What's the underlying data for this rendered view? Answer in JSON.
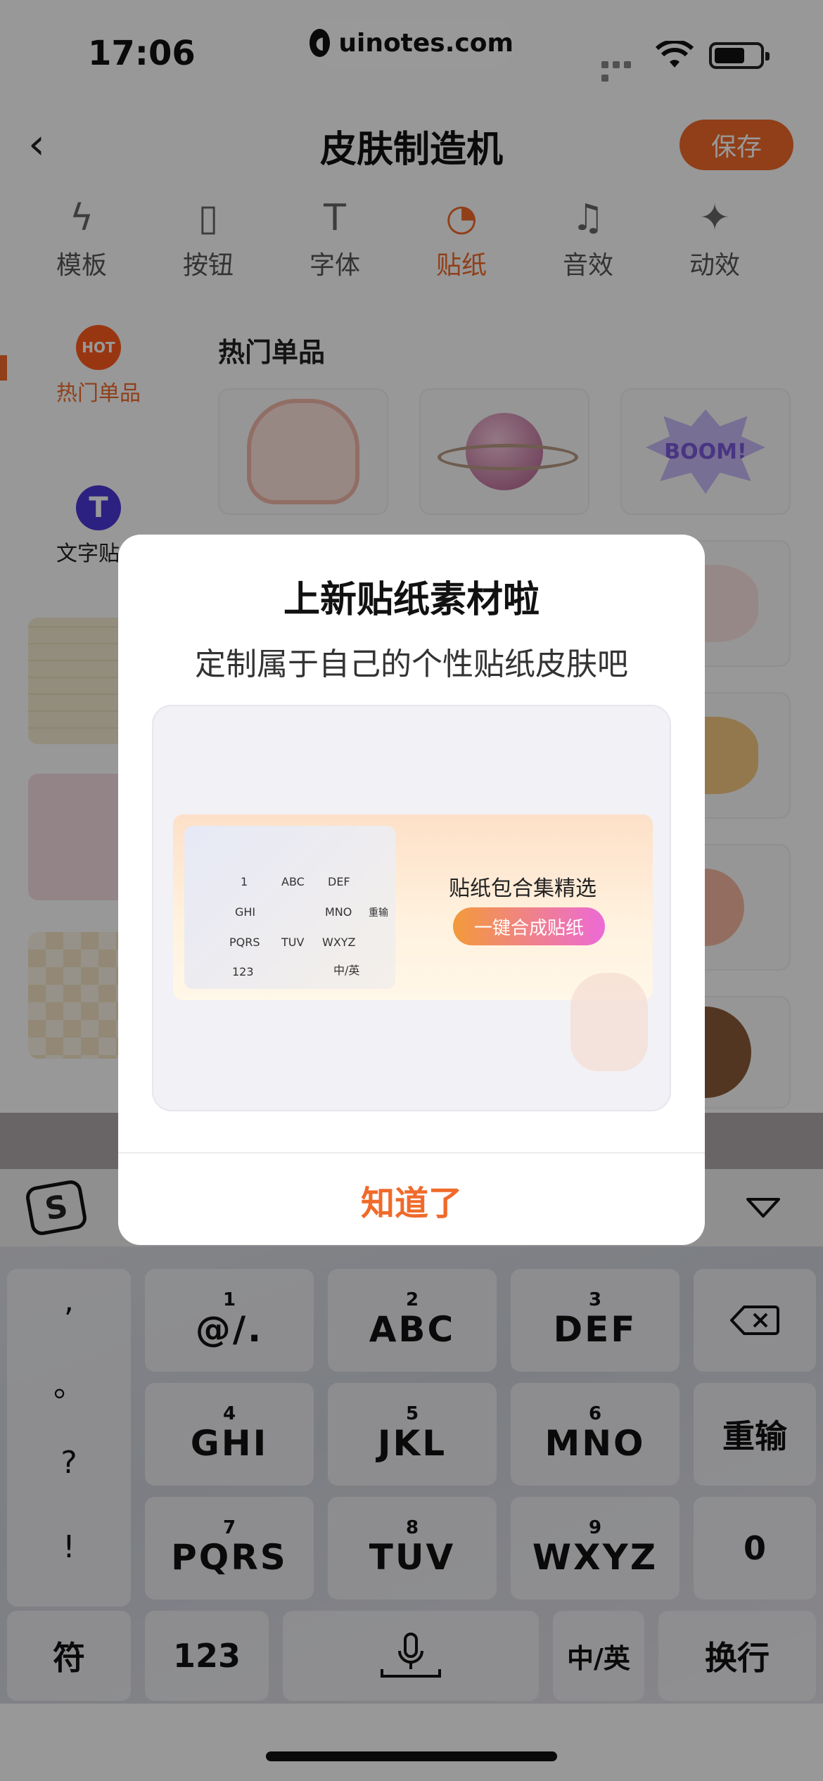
{
  "status": {
    "time": "17:06",
    "watermark": "uinotes.com"
  },
  "nav": {
    "title": "皮肤制造机",
    "save": "保存"
  },
  "tabs": [
    {
      "label": "模板",
      "icon": "lightning-icon",
      "active": false
    },
    {
      "label": "按钮",
      "icon": "rectangle-icon",
      "active": false
    },
    {
      "label": "字体",
      "icon": "text-t-icon",
      "active": false
    },
    {
      "label": "贴纸",
      "icon": "sticker-icon",
      "active": true
    },
    {
      "label": "音效",
      "icon": "music-note-icon",
      "active": false
    },
    {
      "label": "动效",
      "icon": "sparkle-icon",
      "active": false
    }
  ],
  "rail": {
    "hot_badge": "HOT",
    "hot_label": "热门单品",
    "text_badge": "T",
    "text_label": "文字贴纸"
  },
  "section": {
    "title": "热门单品",
    "boom": "BOOM!"
  },
  "dialog": {
    "title": "上新贴纸素材啦",
    "subtitle": "定制属于自己的个性贴纸皮肤吧",
    "banner_title": "贴纸包合集精选",
    "banner_button": "一键合成贴纸",
    "confirm": "知道了",
    "mini_keys": [
      "1",
      "ABC",
      "DEF",
      "GHI",
      "MNO",
      "重输",
      "PQRS",
      "TUV",
      "WXYZ",
      "123",
      "中/英"
    ]
  },
  "keyboard": {
    "punct": [
      ",",
      "。",
      "?",
      "!"
    ],
    "keys": [
      {
        "num": "1",
        "letters": "@/."
      },
      {
        "num": "2",
        "letters": "ABC"
      },
      {
        "num": "3",
        "letters": "DEF"
      },
      {
        "num": "4",
        "letters": "GHI"
      },
      {
        "num": "5",
        "letters": "JKL"
      },
      {
        "num": "6",
        "letters": "MNO"
      },
      {
        "num": "7",
        "letters": "PQRS"
      },
      {
        "num": "8",
        "letters": "TUV"
      },
      {
        "num": "9",
        "letters": "WXYZ"
      }
    ],
    "reenter": "重输",
    "zero": "0",
    "symbols": "符",
    "numbers": "123",
    "lang": "中/英",
    "enter": "换行",
    "logo": "S"
  }
}
